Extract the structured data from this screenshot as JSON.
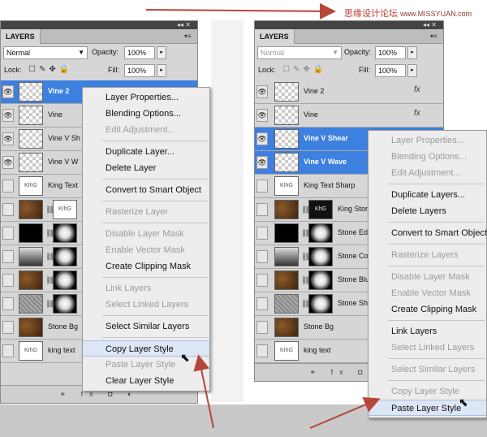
{
  "watermark": {
    "text": "思缘设计论坛",
    "url": "www.MISSYUAN.com"
  },
  "panel_left": {
    "tab": "LAYERS",
    "blend_mode": "Normal",
    "opacity_label": "Opacity:",
    "opacity_value": "100%",
    "lock_label": "Lock:",
    "fill_label": "Fill:",
    "fill_value": "100%",
    "layers": [
      {
        "name": "Vine 2",
        "thumb": "checker",
        "selected": true
      },
      {
        "name": "Vine",
        "thumb": "checker",
        "selected": false
      },
      {
        "name": "Vine V Sh",
        "thumb": "checker",
        "selected": false
      },
      {
        "name": "Vine V W",
        "thumb": "checker",
        "selected": false
      },
      {
        "name": "King Text",
        "thumb": "text",
        "thumb_text": "KIhG",
        "selected": false
      },
      {
        "name": "",
        "thumb": "stone",
        "mask": "text",
        "mask_text": "KIhG",
        "selected": false
      },
      {
        "name": "",
        "thumb": "black",
        "mask": "mask-radial",
        "selected": false
      },
      {
        "name": "",
        "thumb": "grad",
        "mask": "mask-radial",
        "selected": false
      },
      {
        "name": "",
        "thumb": "stone",
        "mask": "mask-radial",
        "selected": false
      },
      {
        "name": "",
        "thumb": "gray",
        "mask": "mask-radial",
        "selected": false
      },
      {
        "name": "Stone Bg",
        "thumb": "stone",
        "selected": false
      },
      {
        "name": "king text",
        "thumb": "text",
        "thumb_text": "KIhG",
        "selected": false
      }
    ]
  },
  "panel_right": {
    "tab": "LAYERS",
    "blend_mode": "Normal",
    "opacity_label": "Opacity:",
    "opacity_value": "100%",
    "lock_label": "Lock:",
    "fill_label": "Fill:",
    "fill_value": "100%",
    "layers": [
      {
        "name": "Vine 2",
        "thumb": "checker",
        "selected": false,
        "fx": "fx"
      },
      {
        "name": "Vine",
        "thumb": "checker",
        "selected": false,
        "fx": "fx"
      },
      {
        "name": "Vine V Shear",
        "thumb": "checker",
        "selected": true
      },
      {
        "name": "Vine V Wave",
        "thumb": "checker",
        "selected": true
      },
      {
        "name": "King Text Sharp",
        "thumb": "text",
        "thumb_text": "KIhG",
        "selected": false
      },
      {
        "name": "King Ston",
        "thumb": "stone",
        "mask": "text dark",
        "mask_text": "KhG",
        "selected": false
      },
      {
        "name": "Stone Ed",
        "thumb": "black",
        "mask": "mask-radial",
        "selected": false
      },
      {
        "name": "Stone Co",
        "thumb": "grad",
        "mask": "mask-radial",
        "selected": false
      },
      {
        "name": "Stone Blu",
        "thumb": "stone",
        "mask": "mask-radial",
        "selected": false
      },
      {
        "name": "Stone Sha",
        "thumb": "gray",
        "mask": "mask-radial",
        "selected": false
      },
      {
        "name": "Stone Bg",
        "thumb": "stone",
        "selected": false
      },
      {
        "name": "king text",
        "thumb": "text",
        "thumb_text": "KIhG",
        "selected": false
      }
    ]
  },
  "menu_left": {
    "items": [
      {
        "label": "Layer Properties...",
        "disabled": false
      },
      {
        "label": "Blending Options...",
        "disabled": false
      },
      {
        "label": "Edit Adjustment...",
        "disabled": true
      },
      {
        "sep": true
      },
      {
        "label": "Duplicate Layer...",
        "disabled": false
      },
      {
        "label": "Delete Layer",
        "disabled": false
      },
      {
        "sep": true
      },
      {
        "label": "Convert to Smart Object",
        "disabled": false
      },
      {
        "sep": true
      },
      {
        "label": "Rasterize Layer",
        "disabled": true
      },
      {
        "sep": true
      },
      {
        "label": "Disable Layer Mask",
        "disabled": true
      },
      {
        "label": "Enable Vector Mask",
        "disabled": true
      },
      {
        "label": "Create Clipping Mask",
        "disabled": false
      },
      {
        "sep": true
      },
      {
        "label": "Link Layers",
        "disabled": true
      },
      {
        "label": "Select Linked Layers",
        "disabled": true
      },
      {
        "sep": true
      },
      {
        "label": "Select Similar Layers",
        "disabled": false
      },
      {
        "sep": true
      },
      {
        "label": "Copy Layer Style",
        "disabled": false,
        "highlight": true
      },
      {
        "label": "Paste Layer Style",
        "disabled": true
      },
      {
        "label": "Clear Layer Style",
        "disabled": false
      }
    ]
  },
  "menu_right": {
    "items": [
      {
        "label": "Layer Properties...",
        "disabled": true
      },
      {
        "label": "Blending Options...",
        "disabled": true
      },
      {
        "label": "Edit Adjustment...",
        "disabled": true
      },
      {
        "sep": true
      },
      {
        "label": "Duplicate Layers...",
        "disabled": false
      },
      {
        "label": "Delete Layers",
        "disabled": false
      },
      {
        "sep": true
      },
      {
        "label": "Convert to Smart Object",
        "disabled": false
      },
      {
        "sep": true
      },
      {
        "label": "Rasterize Layers",
        "disabled": true
      },
      {
        "sep": true
      },
      {
        "label": "Disable Layer Mask",
        "disabled": true
      },
      {
        "label": "Enable Vector Mask",
        "disabled": true
      },
      {
        "label": "Create Clipping Mask",
        "disabled": false
      },
      {
        "sep": true
      },
      {
        "label": "Link Layers",
        "disabled": false
      },
      {
        "label": "Select Linked Layers",
        "disabled": true
      },
      {
        "sep": true
      },
      {
        "label": "Select Similar Layers",
        "disabled": true
      },
      {
        "sep": true
      },
      {
        "label": "Copy Layer Style",
        "disabled": true
      },
      {
        "label": "Paste Layer Style",
        "disabled": false,
        "highlight": true
      }
    ]
  },
  "colors": {
    "selection": "#3d80df",
    "arrow": "#b5473a",
    "panel_bg": "#d6d6d6"
  },
  "icons": [
    "eye-icon",
    "chain-icon",
    "fx-icon",
    "lock-icon",
    "panel-menu-icon",
    "cursor-arrow-icon"
  ]
}
